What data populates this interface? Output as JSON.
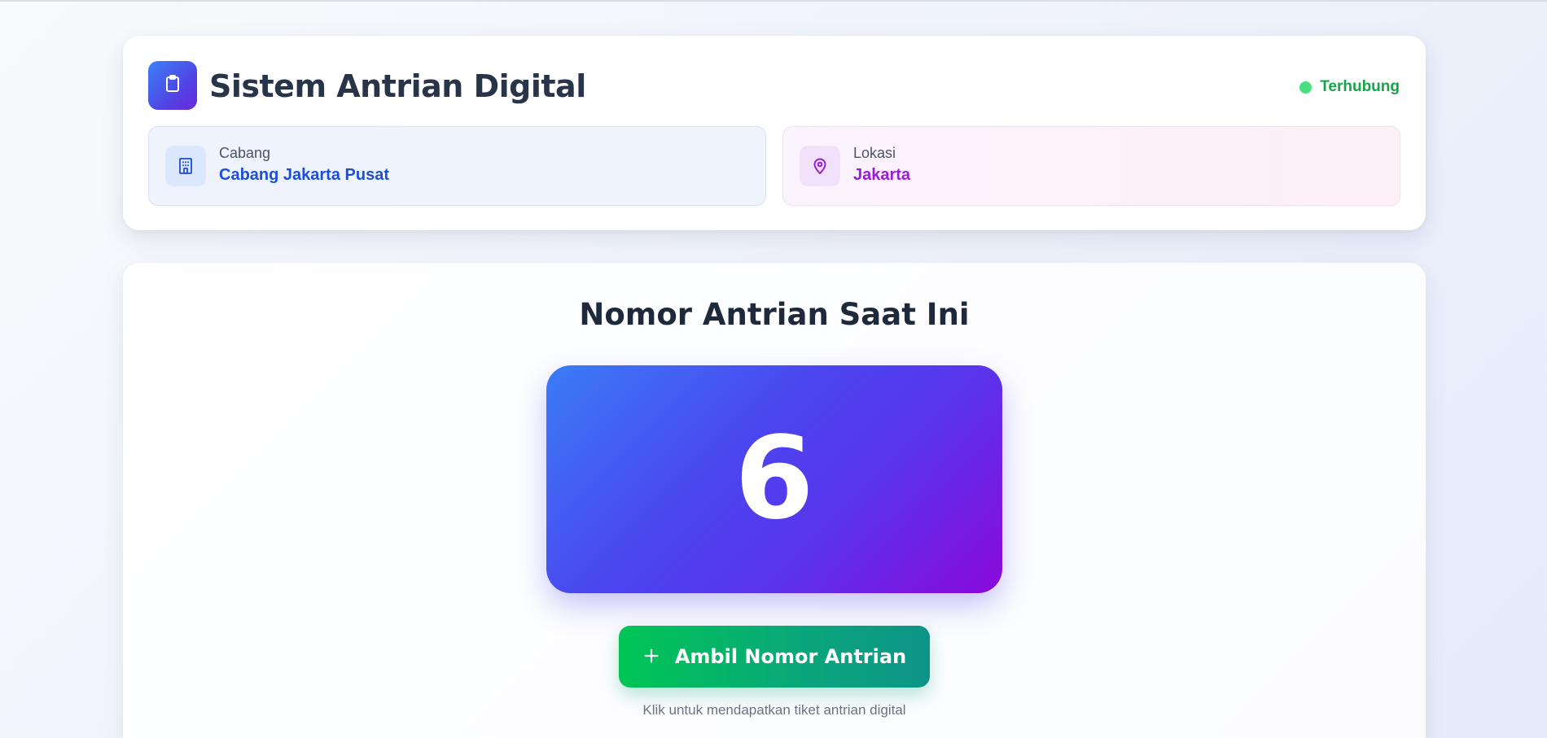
{
  "header": {
    "title": "Sistem Antrian Digital",
    "logo_icon": "clipboard-icon",
    "status_text": "Terhubung",
    "status_color": "#4ade80"
  },
  "branch": {
    "label": "Cabang",
    "value": "Cabang Jakarta Pusat",
    "icon": "building-icon",
    "accent": "#1d4ed8"
  },
  "location": {
    "label": "Lokasi",
    "value": "Jakarta",
    "icon": "map-pin-icon",
    "accent": "#9b1bd6"
  },
  "queue": {
    "title": "Nomor Antrian Saat Ini",
    "current_number": "6",
    "button_label": "Ambil Nomor Antrian",
    "button_icon": "plus-icon",
    "hint": "Klik untuk mendapatkan tiket antrian digital"
  }
}
